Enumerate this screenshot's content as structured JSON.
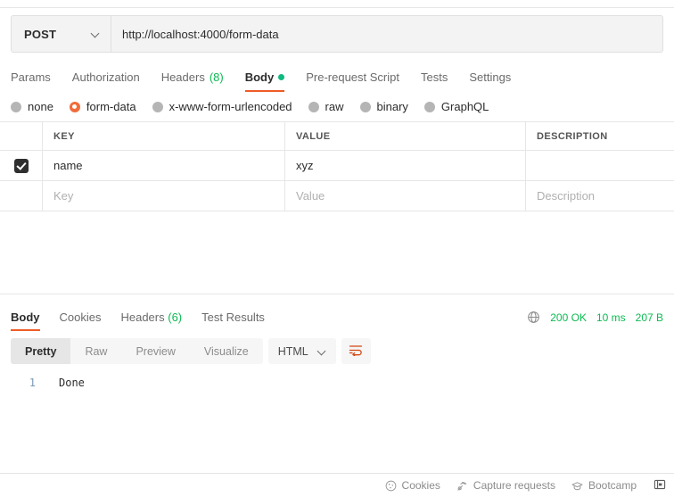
{
  "request": {
    "method": "POST",
    "method_chevron_icon": "chevron-down-icon",
    "url": "http://localhost:4000/form-data",
    "url_placeholder": "Enter request URL",
    "tabs": [
      {
        "label": "Params",
        "count": "",
        "active": false,
        "dot": false
      },
      {
        "label": "Authorization",
        "count": "",
        "active": false,
        "dot": false
      },
      {
        "label": "Headers",
        "count": "(8)",
        "active": false,
        "dot": false
      },
      {
        "label": "Body",
        "count": "",
        "active": true,
        "dot": true
      },
      {
        "label": "Pre-request Script",
        "count": "",
        "active": false,
        "dot": false
      },
      {
        "label": "Tests",
        "count": "",
        "active": false,
        "dot": false
      },
      {
        "label": "Settings",
        "count": "",
        "active": false,
        "dot": false
      }
    ],
    "body_types": [
      {
        "label": "none",
        "selected": false
      },
      {
        "label": "form-data",
        "selected": true
      },
      {
        "label": "x-www-form-urlencoded",
        "selected": false
      },
      {
        "label": "raw",
        "selected": false
      },
      {
        "label": "binary",
        "selected": false
      },
      {
        "label": "GraphQL",
        "selected": false
      }
    ],
    "table": {
      "headers": {
        "key": "KEY",
        "value": "VALUE",
        "description": "DESCRIPTION"
      },
      "rows": [
        {
          "checked": true,
          "key": "name",
          "value": "xyz",
          "description": ""
        }
      ],
      "placeholder_row": {
        "key": "Key",
        "value": "Value",
        "description": "Description"
      }
    }
  },
  "response": {
    "tabs": [
      {
        "label": "Body",
        "count": "",
        "active": true
      },
      {
        "label": "Cookies",
        "count": "",
        "active": false
      },
      {
        "label": "Headers",
        "count": "(6)",
        "active": false
      },
      {
        "label": "Test Results",
        "count": "",
        "active": false
      }
    ],
    "status": {
      "globe_icon": "globe-icon",
      "code": "200 OK",
      "time": "10 ms",
      "size": "207 B"
    },
    "viewer": {
      "modes": [
        {
          "label": "Pretty",
          "active": true
        },
        {
          "label": "Raw",
          "active": false
        },
        {
          "label": "Preview",
          "active": false
        },
        {
          "label": "Visualize",
          "active": false
        }
      ],
      "format": "HTML",
      "format_chevron_icon": "chevron-down-icon",
      "wrap_icon": "wrap-text-icon"
    },
    "body": {
      "line_number": "1",
      "content": "Done"
    }
  },
  "statusbar": {
    "items": [
      {
        "label": "Cookies",
        "icon": "cookie-icon"
      },
      {
        "label": "Capture requests",
        "icon": "satellite-icon"
      },
      {
        "label": "Bootcamp",
        "icon": "graduation-cap-icon"
      }
    ],
    "panel_toggle_icon": "panel-toggle-icon"
  },
  "colors": {
    "accent_orange": "#ef5b25",
    "status_green": "#0cbb52",
    "body_dot_green": "#10b981",
    "radio_selected": "#f26b3a"
  }
}
